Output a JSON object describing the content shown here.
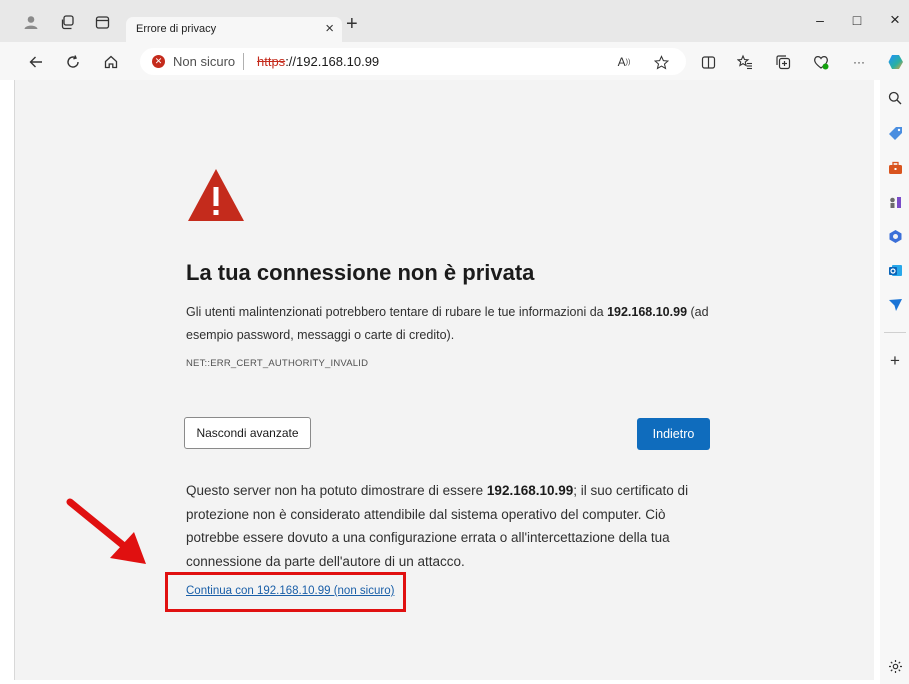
{
  "tab": {
    "title": "Errore di privacy",
    "close_glyph": "×",
    "new_tab_glyph": "+"
  },
  "window": {
    "minimize_glyph": "–",
    "maximize_glyph": "□",
    "close_glyph": "×"
  },
  "address_bar": {
    "security_label": "Non sicuro",
    "url_scheme": "https",
    "url_rest": "://192.168.10.99"
  },
  "toolbar_icons": {
    "read_aloud_glyph": "A",
    "more_glyph": "···"
  },
  "page": {
    "heading": "La tua connessione non è privata",
    "desc_before": "Gli utenti malintenzionati potrebbero tentare di rubare le tue informazioni da ",
    "desc_host": "192.168.10.99",
    "desc_after": " (ad esempio password, messaggi o carte di credito).",
    "error_code": "NET::ERR_CERT_AUTHORITY_INVALID",
    "hide_advanced_label": "Nascondi avanzate",
    "back_label": "Indietro",
    "advanced_before": "Questo server non ha potuto dimostrare di essere ",
    "advanced_host": "192.168.10.99",
    "advanced_after": "; il suo certificato di protezione non è considerato attendibile dal sistema operativo del computer. Ciò potrebbe essere dovuto a una configurazione errata o all'intercettazione della tua connessione da parte dell'autore di un attacco.",
    "proceed_link": "Continua con 192.168.10.99 (non sicuro)"
  },
  "sidebar": {
    "add_glyph": "+"
  },
  "colors": {
    "warning_red": "#c42b1c",
    "primary_blue": "#0f6cbd",
    "annotation_red": "#e01010",
    "link_blue": "#1a5fa8"
  }
}
